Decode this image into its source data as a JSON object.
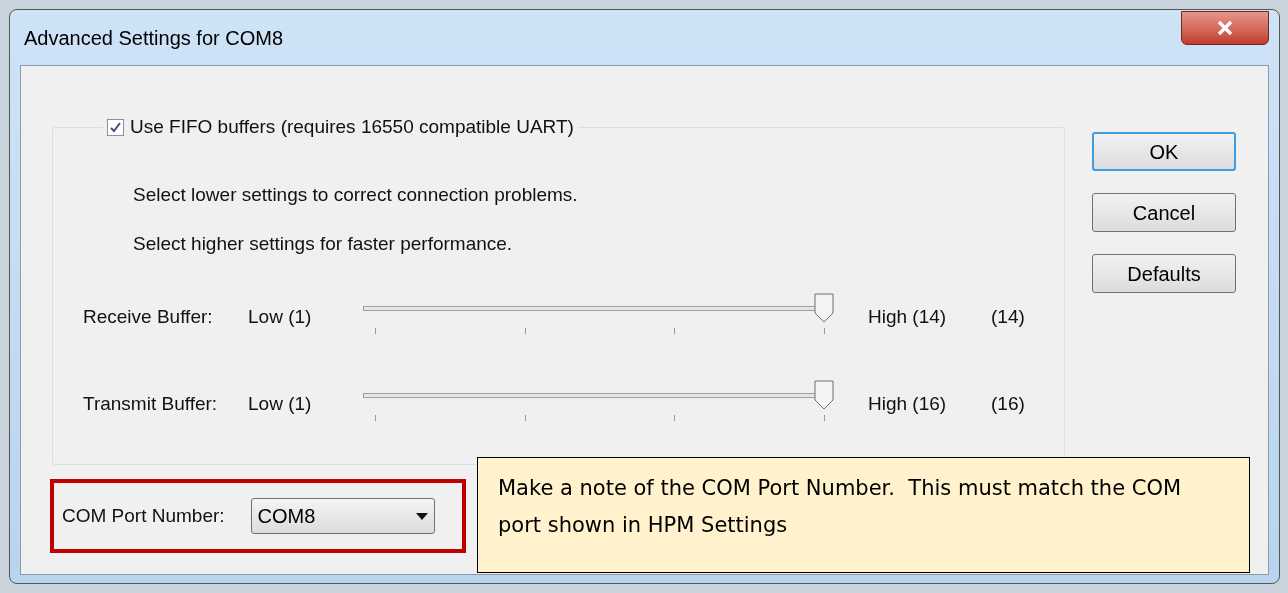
{
  "window": {
    "title": "Advanced Settings for COM8"
  },
  "fifo": {
    "label": "Use FIFO buffers (requires 16550 compatible UART)",
    "checked": true
  },
  "hints": [
    "Select lower settings to correct connection problems.",
    "Select higher settings for faster performance."
  ],
  "sliders": [
    {
      "label": "Receive Buffer:",
      "low": "Low (1)",
      "high": "High (14)",
      "reading": "(14)",
      "level": 1
    },
    {
      "label": "Transmit Buffer:",
      "low": "Low (1)",
      "high": "High (16)",
      "reading": "(16)",
      "level": 1
    }
  ],
  "buttons": [
    {
      "label": "OK",
      "selected": true
    },
    {
      "label": "Cancel",
      "selected": false
    },
    {
      "label": "Defaults",
      "selected": false
    }
  ],
  "com_port": {
    "label": "COM Port Number:",
    "value": "COM8"
  },
  "callout": {
    "text": "Make a note of the COM Port Number.  This must match the COM port shown in HPM Settings"
  }
}
